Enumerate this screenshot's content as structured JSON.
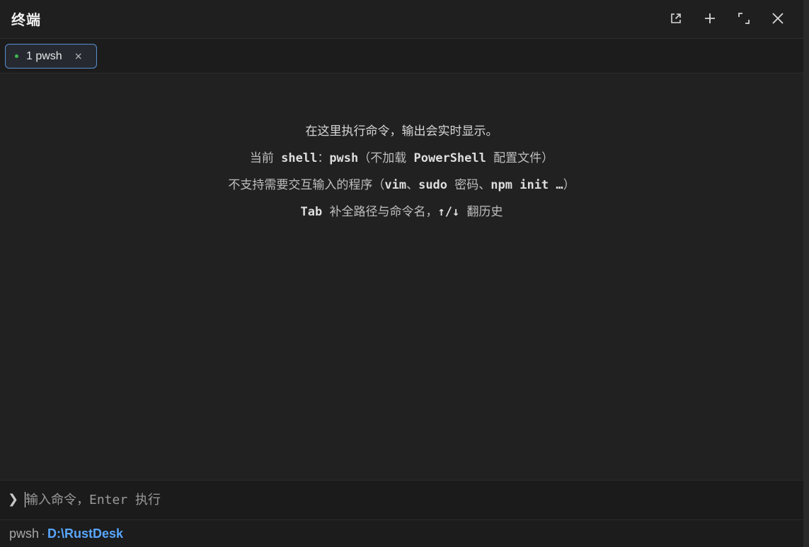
{
  "window": {
    "title": "终端"
  },
  "toolbar": {
    "popout_icon": "external-link-icon",
    "add_icon": "plus-icon",
    "maximize_icon": "expand-icon",
    "close_icon": "close-icon"
  },
  "tabs": [
    {
      "label": "1 pwsh",
      "status_color": "#3fb950",
      "close_glyph": "×",
      "active": true
    }
  ],
  "hints": {
    "line1": "在这里执行命令，输出会实时显示。",
    "line2_pre": "当前 ",
    "line2_shell_kw": "shell",
    "line2_colon": "：",
    "line2_shell_name": "pwsh",
    "line2_mid": "（不加载 ",
    "line2_ps": "PowerShell",
    "line2_post": " 配置文件）",
    "line3_pre": "不支持需要交互输入的程序（",
    "line3_vim": "vim",
    "line3_sep1": "、",
    "line3_sudo": "sudo",
    "line3_mid": " 密码、",
    "line3_npm": "npm init …",
    "line3_post": "）",
    "line4_tab": "Tab",
    "line4_mid": " 补全路径与命令名，",
    "line4_arrows": "↑/↓",
    "line4_post": " 翻历史"
  },
  "input": {
    "prompt_glyph": "❯",
    "value": "",
    "placeholder": "输入命令，Enter 执行"
  },
  "status": {
    "shell": "pwsh",
    "separator": "·",
    "cwd": "D:\\RustDesk"
  },
  "colors": {
    "accent": "#58a6ff",
    "tab_border": "#5a8fd1",
    "running_dot": "#3fb950"
  }
}
